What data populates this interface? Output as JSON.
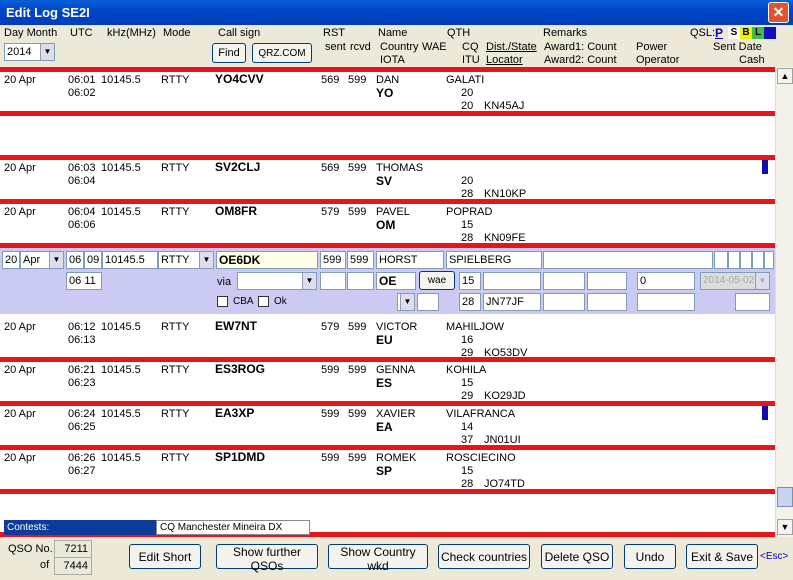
{
  "window": {
    "title": "Edit Log  SE2I"
  },
  "header": {
    "day_month": "Day Month",
    "utc": "UTC",
    "khz": "kHz(MHz)",
    "mode": "Mode",
    "call_sign": "Call sign",
    "rst": "RST",
    "sent": "sent",
    "rcvd": "rcvd",
    "name": "Name",
    "country": "Country",
    "wae": "WAE",
    "iota": "IOTA",
    "qth": "QTH",
    "cq": "CQ",
    "itu": "ITU",
    "dist_state": "Dist./State",
    "locator": "Locator",
    "remarks": "Remarks",
    "award1": "Award1: Count",
    "award2": "Award2: Count",
    "power": "Power",
    "operator": "Operator",
    "qsl": "QSL:",
    "qsl_p": "P",
    "qsl_s": "S",
    "qsl_b": "B",
    "qsl_l": "L",
    "sent_date": "Sent Date",
    "cash": "Cash",
    "year": "2014",
    "find": "Find",
    "qrz": "QRZ.COM"
  },
  "qsos": [
    {
      "date": "20 Apr",
      "utc1": "06:01",
      "utc2": "06:02",
      "freq": "10145.5",
      "mode": "RTTY",
      "call": "YO4CVV",
      "sent": "569",
      "rcvd": "599",
      "name": "DAN",
      "country": "YO",
      "qth": "GALATI",
      "cq": "20",
      "itu": "20",
      "loc": "KN45AJ"
    },
    {
      "date": "20 Apr",
      "utc1": "06:03",
      "utc2": "06:04",
      "freq": "10145.5",
      "mode": "RTTY",
      "call": "SV2CLJ",
      "sent": "569",
      "rcvd": "599",
      "name": "THOMAS",
      "country": "SV",
      "qth": "",
      "cq": "20",
      "itu": "28",
      "loc": "KN10KP"
    },
    {
      "date": "20 Apr",
      "utc1": "06:04",
      "utc2": "06:06",
      "freq": "10145.5",
      "mode": "RTTY",
      "call": "OM8FR",
      "sent": "579",
      "rcvd": "599",
      "name": "PAVEL",
      "country": "OM",
      "qth": "POPRAD",
      "cq": "15",
      "itu": "28",
      "loc": "KN09FE"
    },
    {
      "date": "20 Apr",
      "utc1": "06:12",
      "utc2": "06:13",
      "freq": "10145.5",
      "mode": "RTTY",
      "call": "EW7NT",
      "sent": "579",
      "rcvd": "599",
      "name": "VICTOR",
      "country": "EU",
      "qth": "MAHILJOW",
      "cq": "16",
      "itu": "29",
      "loc": "KO53DV"
    },
    {
      "date": "20 Apr",
      "utc1": "06:21",
      "utc2": "06:23",
      "freq": "10145.5",
      "mode": "RTTY",
      "call": "ES3ROG",
      "sent": "599",
      "rcvd": "599",
      "name": "GENNA",
      "country": "ES",
      "qth": "KOHILA",
      "cq": "15",
      "itu": "29",
      "loc": "KO29JD"
    },
    {
      "date": "20 Apr",
      "utc1": "06:24",
      "utc2": "06:25",
      "freq": "10145.5",
      "mode": "RTTY",
      "call": "EA3XP",
      "sent": "599",
      "rcvd": "599",
      "name": "XAVIER",
      "country": "EA",
      "qth": "VILAFRANCA",
      "cq": "14",
      "itu": "37",
      "loc": "JN01UI"
    },
    {
      "date": "20 Apr",
      "utc1": "06:26",
      "utc2": "06:27",
      "freq": "10145.5",
      "mode": "RTTY",
      "call": "SP1DMD",
      "sent": "599",
      "rcvd": "599",
      "name": "ROMEK",
      "country": "SP",
      "qth": "ROSCIECINO",
      "cq": "15",
      "itu": "28",
      "loc": "JO74TD"
    }
  ],
  "edit": {
    "day": "20",
    "month": "Apr",
    "hh": "06",
    "mm": "09",
    "hh2": "06",
    "mm2": "11",
    "freq": "10145.5",
    "mode": "RTTY",
    "call": "OE6DK",
    "sent": "599",
    "rcvd": "599",
    "name": "HORST",
    "qth": "SPIELBERG",
    "country": "OE",
    "wae": "wae",
    "cq": "15",
    "itu": "28",
    "loc": "JN77JF",
    "via": "via",
    "cba": "CBA",
    "ok": "Ok",
    "power": "0",
    "date": "2014-05-02"
  },
  "contests": {
    "label": "Contests:",
    "value": "CQ Manchester Mineira DX"
  },
  "footer": {
    "qso_no_label": "QSO No.",
    "qso_no": "7211",
    "of_label": "of",
    "total": "7444",
    "edit_short": "Edit Short",
    "show_further": "Show further QSOs",
    "show_country": "Show Country wkd",
    "check_countries": "Check countries",
    "delete_qso": "Delete QSO",
    "undo": "Undo",
    "exit_save": "Exit & Save",
    "esc": "<Esc>"
  }
}
